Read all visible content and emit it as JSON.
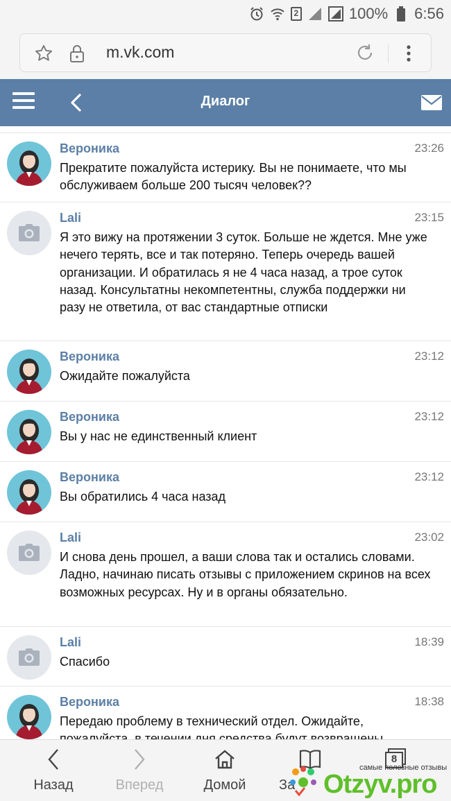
{
  "status": {
    "battery": "100%",
    "time": "6:56",
    "sim_slot": "2"
  },
  "browser": {
    "url": "m.vk.com"
  },
  "header": {
    "title": "Диалог"
  },
  "colors": {
    "header_bg": "#5b7fa6",
    "name_color": "#5b7fa6",
    "avatar_woman_bg": "#6fc4d8",
    "avatar_camera_bg": "#e4e7ec"
  },
  "messages": [
    {
      "name": "Вероника",
      "time": "23:26",
      "avatar": "woman-avatar-icon",
      "text": "Прекратите пожалуйста истерику. Вы не понимаете, что мы обслуживаем больше 200 тысяч человек??"
    },
    {
      "name": "Lali",
      "time": "23:15",
      "avatar": "camera-icon",
      "text": "Я это вижу на протяжении 3 суток. Больше не ждется. Мне уже нечего терять, все и так потеряно. Теперь очередь вашей организации. И обратилась я не 4 часа назад, а трое суток назад. Консультатны некомпетентны, служба поддержки ни разу не ответила, от вас стандартные отписки"
    },
    {
      "name": "Вероника",
      "time": "23:12",
      "avatar": "woman-avatar-icon",
      "text": "Ожидайте пожалуйста"
    },
    {
      "name": "Вероника",
      "time": "23:12",
      "avatar": "woman-avatar-icon",
      "text": "Вы у нас не единственный клиент"
    },
    {
      "name": "Вероника",
      "time": "23:12",
      "avatar": "woman-avatar-icon",
      "text": "Вы обратились 4 часа назад"
    },
    {
      "name": "Lali",
      "time": "23:02",
      "avatar": "camera-icon",
      "text": "И снова день прошел, а ваши слова так и остались словами. Ладно, начинаю писать отзывы с приложением скринов на всех возможных ресурсах. Ну и в органы обязательно."
    },
    {
      "name": "Lali",
      "time": "18:39",
      "avatar": "camera-icon",
      "text": "Спасибо"
    },
    {
      "name": "Вероника",
      "time": "18:38",
      "avatar": "woman-avatar-icon",
      "text": "Передаю проблему в технический отдел. Ожидайте, пожалуйста, в течении дня средства будут возвращены"
    }
  ],
  "bottom_nav": {
    "back": "Назад",
    "forward": "Вперед",
    "home": "Домой",
    "bookmarks": "За",
    "tabs_count": "8"
  },
  "watermark": {
    "tagline": "самые полезные отзывы",
    "brand": "Otzyv.pro"
  }
}
